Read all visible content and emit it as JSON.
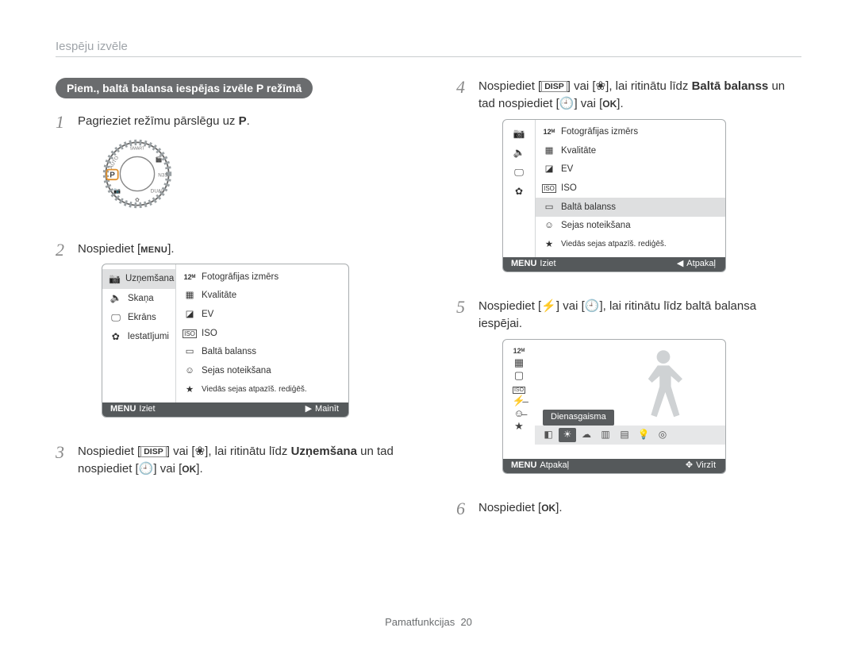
{
  "breadcrumb": "Iespēju izvēle",
  "example_title": "Piem., baltā balansa iespējas izvēle P režīmā",
  "steps": {
    "s1": {
      "num": "1",
      "text_a": "Pagrieziet režīmu pārslēgu uz ",
      "icon": "P",
      "text_b": "."
    },
    "s2": {
      "num": "2",
      "text_a": "Nospiediet [",
      "btn": "MENU",
      "text_b": "]."
    },
    "s3": {
      "num": "3",
      "text_a": "Nospiediet [",
      "icon1": "DISP",
      "text_b": "] vai [",
      "icon2": "tulip",
      "text_c": "], lai ritinātu līdz ",
      "bold": "Uzņemšana",
      "text_d": " un tad nospiediet [",
      "icon3": "timer",
      "text_e": "] vai [",
      "icon4": "OK",
      "text_f": "]."
    },
    "s4": {
      "num": "4",
      "text_a": "Nospiediet [",
      "icon1": "DISP",
      "text_b": "] vai [",
      "icon2": "tulip",
      "text_c": "], lai ritinātu līdz ",
      "bold": "Baltā balanss",
      "text_d": " un tad nospiediet [",
      "icon3": "timer",
      "text_e": "] vai [",
      "icon4": "OK",
      "text_f": "]."
    },
    "s5": {
      "num": "5",
      "text_a": "Nospiediet [",
      "icon1": "flash",
      "text_b": "] vai [",
      "icon2": "timer",
      "text_c": "], lai ritinātu līdz baltā balansa iespējai."
    },
    "s6": {
      "num": "6",
      "text_a": "Nospiediet [",
      "icon": "OK",
      "text_b": "]."
    }
  },
  "lcd_menu_left": {
    "items": [
      {
        "icon": "camera",
        "label": "Uzņemšana",
        "selected": true
      },
      {
        "icon": "speaker",
        "label": "Skaņa",
        "selected": false
      },
      {
        "icon": "monitor",
        "label": "Ekrāns",
        "selected": false
      },
      {
        "icon": "gear",
        "label": "Iestatījumi",
        "selected": false
      }
    ]
  },
  "lcd_menu_right": [
    {
      "icon": "12M",
      "label": "Fotogrāfijas izmērs"
    },
    {
      "icon": "grid",
      "label": "Kvalitāte"
    },
    {
      "icon": "ev",
      "label": "EV"
    },
    {
      "icon": "iso",
      "label": "ISO"
    },
    {
      "icon": "wb",
      "label": "Baltā balanss"
    },
    {
      "icon": "face",
      "label": "Sejas noteikšana"
    },
    {
      "icon": "star",
      "label": "Viedās sejas atpazīš. rediģēš."
    }
  ],
  "lcd2_footer": {
    "left_tag": "MENU",
    "left": "Iziet",
    "right_arrow": "▶",
    "right": "Mainīt"
  },
  "lcd4_selected_index": 4,
  "lcd4_footer": {
    "left_tag": "MENU",
    "left": "Iziet",
    "right_arrow": "◀",
    "right": "Atpakaļ"
  },
  "lcd5": {
    "wb_label": "Dienasgaisma",
    "footer": {
      "left_tag": "MENU",
      "left": "Atpakaļ",
      "right_icon": "✥",
      "right": "Virzīt"
    }
  },
  "footer": {
    "label": "Pamatfunkcijas",
    "page": "20"
  }
}
